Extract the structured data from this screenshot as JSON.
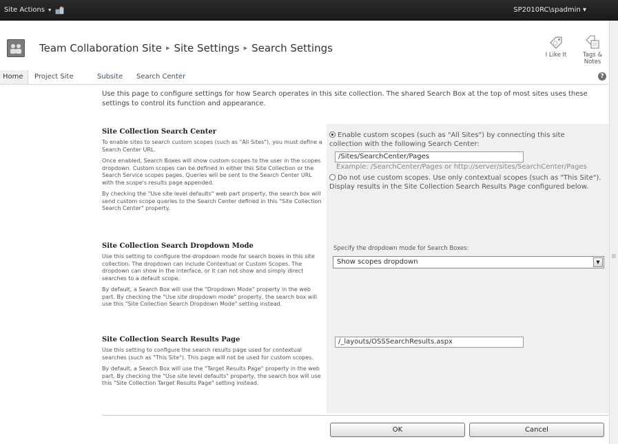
{
  "ribbon": {
    "site_actions_label": "Site Actions",
    "caret": "▾",
    "user": "SP2010RC\\spadmin ▾"
  },
  "breadcrumb": {
    "site": "Team Collaboration Site",
    "settings": "Site Settings",
    "current": "Search Settings",
    "separator": "▸"
  },
  "social": {
    "like_label": "I Like It",
    "tags_label_1": "Tags &",
    "tags_label_2": "Notes"
  },
  "topnav": {
    "items": [
      "Home",
      "Project Site",
      "Subsite",
      "Search Center"
    ],
    "help": "?"
  },
  "intro": "Use this page to configure settings for how Search operates in this site collection.  The shared Search Box at the top of most sites uses these settings to control its function and appearance.",
  "search_center": {
    "title": "Site Collection Search Center",
    "desc": [
      "To enable sites to search custom scopes (such as \"All Sites\"), you must define a Search Center URL.",
      "Once enabled, Search Boxes will show custom scopes to the user in the scopes dropdown.  Custom scopes can be defined in either this Site Collection or the Search Service scopes pages.  Queries will be sent to the Search Center URL with the scope's results page appended.",
      "By checking the \"Use site level defaults\" web part property, the search box will send custom scope queries to the Search Center defined in this \"Site Collection Search Center\" property."
    ],
    "option_enable": "Enable custom scopes (such as \"All Sites\") by connecting this site collection with the following Search Center:",
    "url_value": "/Sites/SearchCenter/Pages",
    "example": "Example: /SearchCenter/Pages or http://server/sites/SearchCenter/Pages",
    "option_disable": "Do not use custom scopes. Use only contextual scopes (such as \"This Site\"). Display results in the Site Collection Search Results Page configured below."
  },
  "dropdown_mode": {
    "title": "Site Collection Search Dropdown Mode",
    "desc": [
      "Use this setting to configure the dropdown mode for search boxes in this site collection.  The dropdown can include Contextual or Custom Scopes.  The dropdown can show in the interface, or it can not show and simply direct searches to a default scope.",
      "By default, a Search Box will use the \"Dropdown Mode\" property in the web part.  By checking the \"Use site dropdown mode\" property, the search box will use this \"Site Collection Search Dropdown Mode\" setting instead."
    ],
    "label": "Specify the dropdown mode for Search Boxes:",
    "selected": "Show scopes dropdown"
  },
  "results_page": {
    "title": "Site Collection Search Results Page",
    "desc": [
      "Use this setting to configure the search results page used for contextual searches (such as \"This Site\").  This page will not be used for custom scopes.",
      "By default, a Search Box will use the \"Target Results Page\" property in the web part.  By checking the \"Use site level defaults\" property, the search box will use this \"Site Collection Target Results Page\" setting instead."
    ],
    "url_value": "/_layouts/OSSSearchResults.aspx"
  },
  "buttons": {
    "ok": "OK",
    "cancel": "Cancel"
  }
}
